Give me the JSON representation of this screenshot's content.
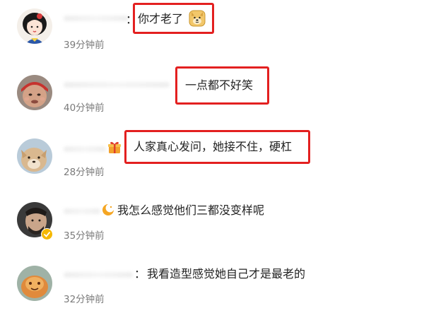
{
  "comments": [
    {
      "text": "你才老了",
      "emoji": "doge-emoji",
      "time": "39分钟前",
      "highlighted": true
    },
    {
      "text": "一点都不好笑",
      "time": "40分钟前",
      "highlighted": true
    },
    {
      "text": "人家真心发问，她接不住，硬杠",
      "time": "28分钟前",
      "highlighted": true,
      "badge": "gift-badge-icon"
    },
    {
      "text": "我怎么感觉他们三都没变样呢",
      "time": "35分钟前",
      "highlighted": false,
      "badge": "fan-badge-icon",
      "verified": true
    },
    {
      "text": "我看造型感觉她自己才是最老的",
      "time": "32分钟前",
      "highlighted": false
    }
  ],
  "colon": "：",
  "highlight_color": "#e32020"
}
